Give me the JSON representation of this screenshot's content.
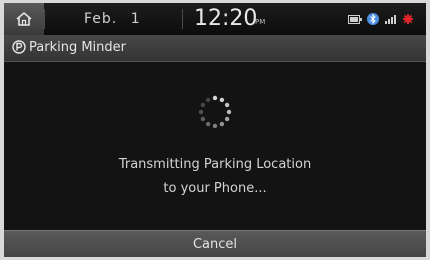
{
  "status_bar": {
    "date": "Feb. 1",
    "time": "12:20",
    "ampm": "PM",
    "icons": [
      "home-icon",
      "battery-icon",
      "bluetooth-icon",
      "signal-icon",
      "alert-icon"
    ],
    "alert_color": "#e0262b",
    "bluetooth_color": "#4b8de0"
  },
  "header": {
    "title": "Parking Minder",
    "icon": "parking-icon"
  },
  "main": {
    "spinner": "loading-spinner",
    "message_line1": "Transmitting Parking Location",
    "message_line2": "to your Phone..."
  },
  "footer": {
    "cancel_label": "Cancel"
  }
}
